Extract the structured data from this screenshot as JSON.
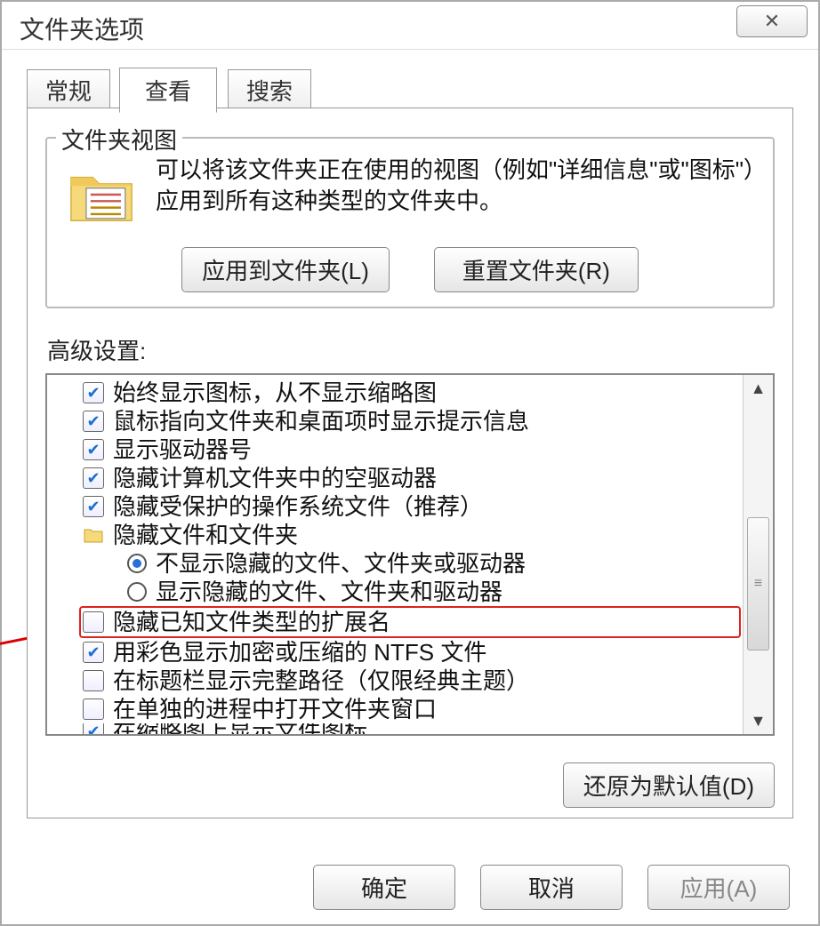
{
  "window": {
    "title": "文件夹选项",
    "close_glyph": "✕"
  },
  "tabs": {
    "general": "常规",
    "view": "查看",
    "search": "搜索"
  },
  "folder_views": {
    "legend": "文件夹视图",
    "description": "可以将该文件夹正在使用的视图（例如\"详细信息\"或\"图标\"）应用到所有这种类型的文件夹中。",
    "apply_label": "应用到文件夹(L)",
    "reset_label": "重置文件夹(R)"
  },
  "advanced": {
    "label": "高级设置:",
    "restore_defaults_label": "还原为默认值(D)",
    "items": [
      {
        "type": "check",
        "checked": true,
        "label": "始终显示图标，从不显示缩略图"
      },
      {
        "type": "check",
        "checked": true,
        "label": "鼠标指向文件夹和桌面项时显示提示信息"
      },
      {
        "type": "check",
        "checked": true,
        "label": "显示驱动器号"
      },
      {
        "type": "check",
        "checked": true,
        "label": "隐藏计算机文件夹中的空驱动器"
      },
      {
        "type": "check",
        "checked": true,
        "label": "隐藏受保护的操作系统文件（推荐）"
      },
      {
        "type": "folder",
        "label": "隐藏文件和文件夹"
      },
      {
        "type": "radio",
        "selected": true,
        "indent": true,
        "label": "不显示隐藏的文件、文件夹或驱动器"
      },
      {
        "type": "radio",
        "selected": false,
        "indent": true,
        "label": "显示隐藏的文件、文件夹和驱动器"
      },
      {
        "type": "check",
        "checked": false,
        "highlight": true,
        "label": "隐藏已知文件类型的扩展名"
      },
      {
        "type": "check",
        "checked": true,
        "label": "用彩色显示加密或压缩的 NTFS 文件"
      },
      {
        "type": "check",
        "checked": false,
        "label": "在标题栏显示完整路径（仅限经典主题）"
      },
      {
        "type": "check",
        "checked": false,
        "label": "在单独的进程中打开文件夹窗口"
      },
      {
        "type": "check",
        "checked": true,
        "cut": true,
        "label": "在缩略图上显示文件图标"
      }
    ]
  },
  "buttons": {
    "ok": "确定",
    "cancel": "取消",
    "apply": "应用(A)"
  }
}
